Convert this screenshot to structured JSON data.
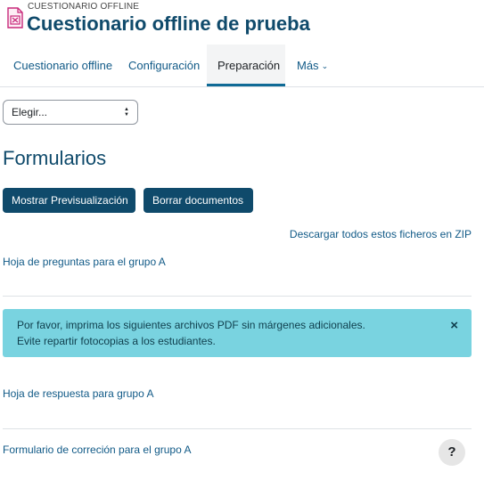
{
  "header": {
    "activity_type": "CUESTIONARIO OFFLINE",
    "title": "Cuestionario offline de prueba",
    "icon": "offline-quiz-icon",
    "icon_color": "#c8287a"
  },
  "nav": {
    "tabs": [
      {
        "label": "Cuestionario offline",
        "active": false
      },
      {
        "label": "Configuración",
        "active": false
      },
      {
        "label": "Preparación",
        "active": true
      },
      {
        "label": "Más",
        "active": false
      }
    ]
  },
  "select": {
    "value": "Elegir..."
  },
  "section": {
    "title": "Formularios"
  },
  "buttons": {
    "preview_label": "Mostrar Previsualización",
    "delete_label": "Borrar documentos"
  },
  "zip_link": "Descargar todos estos ficheros en ZIP",
  "documents": [
    "Hoja de preguntas para el grupo A",
    "Hoja de respuesta para grupo A",
    "Formulario de correción para el grupo A"
  ],
  "alert": {
    "line1": "Por favor, imprima los siguientes archivos PDF sin márgenes adicionales.",
    "line2": "Evite repartir fotocopias a los estudiantes.",
    "close_symbol": "×"
  },
  "help": {
    "label": "?"
  },
  "colors": {
    "brand": "#0f4a6b",
    "link": "#115a87",
    "alert_bg": "#79d3e0"
  }
}
